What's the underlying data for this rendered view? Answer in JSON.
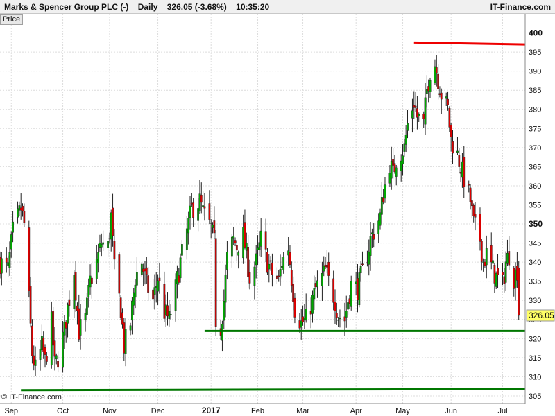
{
  "header": {
    "name": "Marks & Spencer Group PLC (-)",
    "interval": "Daily",
    "price_change": "326.05 (-3.68%)",
    "time": "10:35:20",
    "brand": "IT-Finance.com"
  },
  "panel": {
    "tab": "Price"
  },
  "footer": {
    "copyright": "© IT-Finance.com"
  },
  "colors": {
    "up": "#00aa00",
    "down": "#dd0000",
    "support": "#007700",
    "resistance": "#ee0000",
    "last_price": "#ffff66"
  },
  "chart_data": {
    "type": "candlestick",
    "title": "",
    "ylim": [
      303,
      405
    ],
    "x_range": [
      "2016-08-25",
      "2017-07-17"
    ],
    "y_ticks": [
      305,
      310,
      315,
      320,
      325,
      330,
      335,
      340,
      345,
      350,
      355,
      360,
      365,
      370,
      375,
      380,
      385,
      390,
      395,
      400
    ],
    "y_bold_ticks": [
      350,
      400
    ],
    "x_ticks": [
      {
        "label": "Sep",
        "date": "2016-09-01"
      },
      {
        "label": "Oct",
        "date": "2016-10-03"
      },
      {
        "label": "Nov",
        "date": "2016-11-01"
      },
      {
        "label": "Dec",
        "date": "2016-12-01"
      },
      {
        "label": "2017",
        "date": "2017-01-03"
      },
      {
        "label": "Feb",
        "date": "2017-02-01"
      },
      {
        "label": "Mar",
        "date": "2017-03-01"
      },
      {
        "label": "Apr",
        "date": "2017-04-03"
      },
      {
        "label": "May",
        "date": "2017-05-02"
      },
      {
        "label": "Jun",
        "date": "2017-06-01"
      },
      {
        "label": "Jul",
        "date": "2017-07-03"
      }
    ],
    "last_price": {
      "value": 326.05,
      "label": "326.05"
    },
    "trendlines": [
      {
        "name": "resistance",
        "color": "#ee0000",
        "x1": "2017-05-09",
        "y1": 397.5,
        "x2": "2017-07-17",
        "y2": 397.0
      },
      {
        "name": "support-upper",
        "color": "#007700",
        "x1": "2016-12-30",
        "y1": 322.0,
        "x2": "2017-07-17",
        "y2": 322.0
      },
      {
        "name": "support-lower",
        "color": "#007700",
        "x1": "2016-09-07",
        "y1": 306.5,
        "x2": "2017-07-17",
        "y2": 306.8
      }
    ],
    "path": [
      [
        "2016-08-25",
        340
      ],
      [
        "2016-08-30",
        338
      ],
      [
        "2016-09-02",
        348
      ],
      [
        "2016-09-07",
        354
      ],
      [
        "2016-09-09",
        350
      ],
      [
        "2016-09-12",
        330
      ],
      [
        "2016-09-14",
        316
      ],
      [
        "2016-09-16",
        312
      ],
      [
        "2016-09-20",
        318
      ],
      [
        "2016-09-22",
        314
      ],
      [
        "2016-09-26",
        324
      ],
      [
        "2016-09-28",
        313
      ],
      [
        "2016-09-30",
        315
      ],
      [
        "2016-10-04",
        322
      ],
      [
        "2016-10-06",
        328
      ],
      [
        "2016-10-10",
        338
      ],
      [
        "2016-10-13",
        322
      ],
      [
        "2016-10-17",
        325
      ],
      [
        "2016-10-20",
        335
      ],
      [
        "2016-10-24",
        340
      ],
      [
        "2016-10-27",
        345
      ],
      [
        "2016-10-31",
        344
      ],
      [
        "2016-11-02",
        352
      ],
      [
        "2016-11-04",
        338
      ],
      [
        "2016-11-08",
        328
      ],
      [
        "2016-11-10",
        318
      ],
      [
        "2016-11-14",
        324
      ],
      [
        "2016-11-17",
        336
      ],
      [
        "2016-11-21",
        340
      ],
      [
        "2016-11-24",
        334
      ],
      [
        "2016-11-28",
        330
      ],
      [
        "2016-12-01",
        336
      ],
      [
        "2016-12-05",
        327
      ],
      [
        "2016-12-08",
        325
      ],
      [
        "2016-12-12",
        333
      ],
      [
        "2016-12-15",
        340
      ],
      [
        "2016-12-19",
        348
      ],
      [
        "2016-12-22",
        354
      ],
      [
        "2016-12-27",
        356
      ],
      [
        "2016-12-29",
        353
      ],
      [
        "2017-01-03",
        349
      ],
      [
        "2017-01-05",
        345
      ],
      [
        "2017-01-06",
        325
      ],
      [
        "2017-01-09",
        323
      ],
      [
        "2017-01-11",
        330
      ],
      [
        "2017-01-13",
        341
      ],
      [
        "2017-01-17",
        346
      ],
      [
        "2017-01-19",
        344
      ],
      [
        "2017-01-23",
        347
      ],
      [
        "2017-01-25",
        342
      ],
      [
        "2017-01-27",
        336
      ],
      [
        "2017-01-31",
        340
      ],
      [
        "2017-02-03",
        346
      ],
      [
        "2017-02-07",
        340
      ],
      [
        "2017-02-10",
        337
      ],
      [
        "2017-02-14",
        335
      ],
      [
        "2017-02-16",
        340
      ],
      [
        "2017-02-20",
        344
      ],
      [
        "2017-02-22",
        336
      ],
      [
        "2017-02-24",
        328
      ],
      [
        "2017-02-28",
        324
      ],
      [
        "2017-03-03",
        325
      ],
      [
        "2017-03-07",
        330
      ],
      [
        "2017-03-09",
        333
      ],
      [
        "2017-03-13",
        336
      ],
      [
        "2017-03-15",
        338
      ],
      [
        "2017-03-17",
        335
      ],
      [
        "2017-03-21",
        330
      ],
      [
        "2017-03-23",
        326
      ],
      [
        "2017-03-27",
        325
      ],
      [
        "2017-03-29",
        330
      ],
      [
        "2017-03-31",
        334
      ],
      [
        "2017-04-04",
        333
      ],
      [
        "2017-04-06",
        336
      ],
      [
        "2017-04-10",
        342
      ],
      [
        "2017-04-12",
        346
      ],
      [
        "2017-04-18",
        352
      ],
      [
        "2017-04-20",
        358
      ],
      [
        "2017-04-24",
        366
      ],
      [
        "2017-04-26",
        363
      ],
      [
        "2017-04-28",
        367
      ],
      [
        "2017-05-03",
        370
      ],
      [
        "2017-05-05",
        376
      ],
      [
        "2017-05-09",
        382
      ],
      [
        "2017-05-11",
        378
      ],
      [
        "2017-05-15",
        376
      ],
      [
        "2017-05-17",
        385
      ],
      [
        "2017-05-19",
        390
      ],
      [
        "2017-05-22",
        392
      ],
      [
        "2017-05-24",
        388
      ],
      [
        "2017-05-26",
        384
      ],
      [
        "2017-05-30",
        380
      ],
      [
        "2017-06-01",
        372
      ],
      [
        "2017-06-05",
        368
      ],
      [
        "2017-06-07",
        365
      ],
      [
        "2017-06-09",
        362
      ],
      [
        "2017-06-13",
        356
      ],
      [
        "2017-06-15",
        350
      ],
      [
        "2017-06-19",
        346
      ],
      [
        "2017-06-21",
        340
      ],
      [
        "2017-06-23",
        342
      ],
      [
        "2017-06-27",
        338
      ],
      [
        "2017-06-29",
        336
      ],
      [
        "2017-07-03",
        334
      ],
      [
        "2017-07-05",
        340
      ],
      [
        "2017-07-07",
        342
      ],
      [
        "2017-07-10",
        336
      ],
      [
        "2017-07-12",
        338
      ],
      [
        "2017-07-13",
        326.05
      ]
    ]
  }
}
